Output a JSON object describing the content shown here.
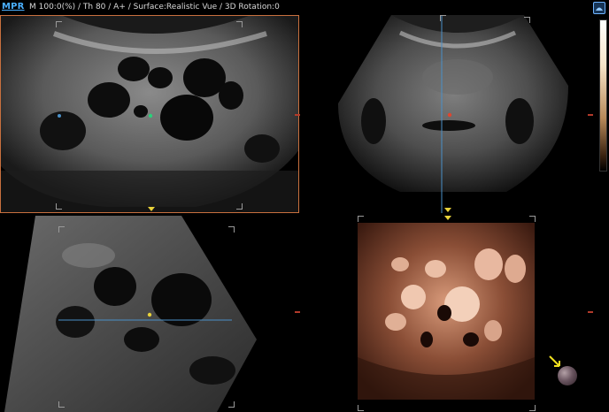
{
  "header": {
    "mode_tab": "MPR",
    "status": "M 100:0(%) / Th 80 / A+ / Surface:Realistic Vue / 3D Rotation:0"
  },
  "icons": {
    "probe": "probe-icon",
    "orientation": "orientation-sphere-icon",
    "arrow": "yellow-arrow-icon"
  },
  "colors": {
    "active_frame": "#c8703e",
    "cursor_line": "#4a90c8",
    "mode_tab": "#4ab0ff",
    "marker_green": "#2ad17a",
    "marker_red": "#e0452f",
    "marker_yellow": "#e8d23a",
    "render_tone": "#c98a70"
  }
}
